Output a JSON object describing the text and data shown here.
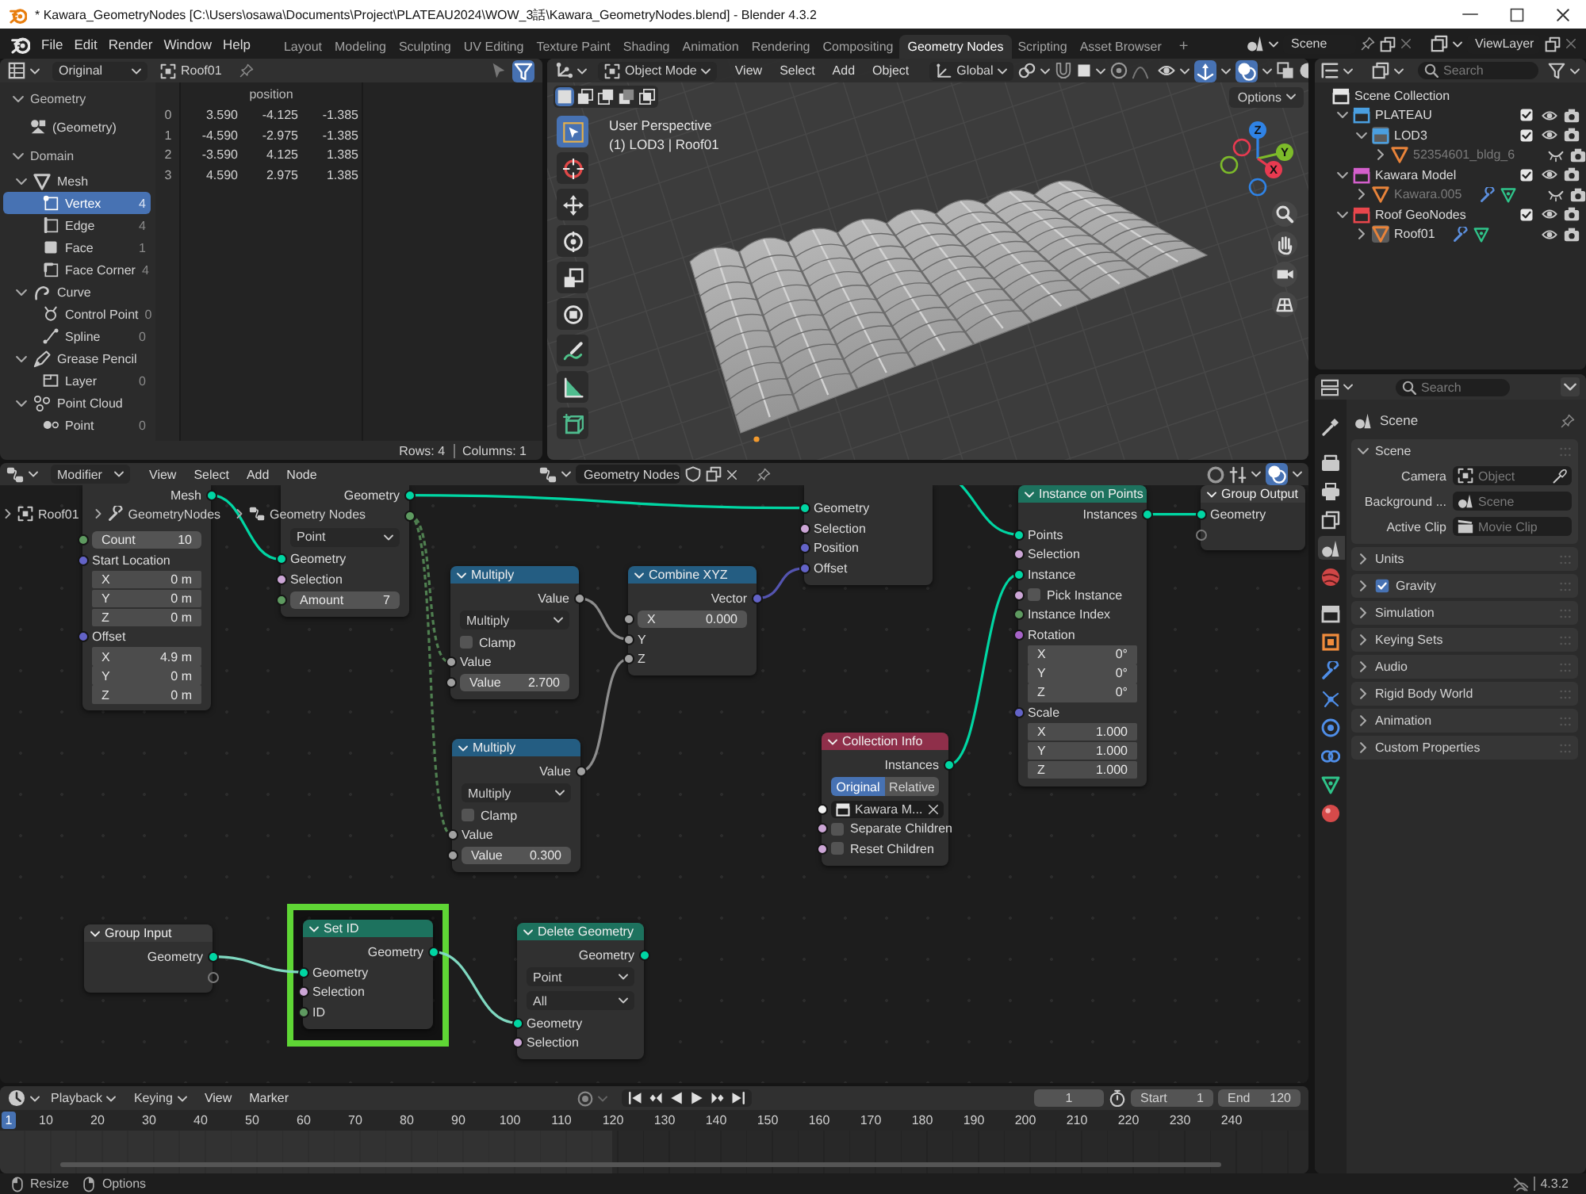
{
  "window": {
    "title": "* Kawara_GeometryNodes [C:\\Users\\osawa\\Documents\\Project\\PLATEAU2024\\WOW_3話\\Kawara_GeometryNodes.blend] - Blender 4.3.2"
  },
  "menu_bar": {
    "menus": [
      "File",
      "Edit",
      "Render",
      "Window",
      "Help"
    ],
    "workspaces": [
      {
        "label": "Layout",
        "selected": false
      },
      {
        "label": "Modeling",
        "selected": false
      },
      {
        "label": "Sculpting",
        "selected": false
      },
      {
        "label": "UV Editing",
        "selected": false
      },
      {
        "label": "Texture Paint",
        "selected": false
      },
      {
        "label": "Shading",
        "selected": false
      },
      {
        "label": "Animation",
        "selected": false
      },
      {
        "label": "Rendering",
        "selected": false
      },
      {
        "label": "Compositing",
        "selected": false
      },
      {
        "label": "Geometry Nodes",
        "selected": true
      },
      {
        "label": "Scripting",
        "selected": false
      },
      {
        "label": "Asset Browser",
        "selected": false
      }
    ],
    "add_workspace": "+",
    "scene": "Scene",
    "view_layer": "ViewLayer"
  },
  "spreadsheet": {
    "display": "Original",
    "object": "Roof01",
    "tree": [
      {
        "label": "Geometry",
        "kind": "section",
        "expanded": true,
        "children": [
          {
            "label": "(Geometry)",
            "kind": "geometry",
            "selected": false
          }
        ]
      },
      {
        "label": "Domain",
        "kind": "section",
        "expanded": true,
        "children": [
          {
            "label": "Mesh",
            "kind": "mesh",
            "expanded": true,
            "children": [
              {
                "label": "Vertex",
                "kind": "vertex",
                "count": "4",
                "selected": true
              },
              {
                "label": "Edge",
                "kind": "edge",
                "count": "4",
                "selected": false
              },
              {
                "label": "Face",
                "kind": "face",
                "count": "1",
                "selected": false
              },
              {
                "label": "Face Corner",
                "kind": "corner",
                "count": "4",
                "selected": false
              }
            ]
          },
          {
            "label": "Curve",
            "kind": "curve",
            "expanded": true,
            "children": [
              {
                "label": "Control Point",
                "kind": "cpoint",
                "count": "0",
                "selected": false
              },
              {
                "label": "Spline",
                "kind": "spline",
                "count": "0",
                "selected": false
              }
            ]
          },
          {
            "label": "Grease Pencil",
            "kind": "gpencil",
            "expanded": true,
            "children": [
              {
                "label": "Layer",
                "kind": "layer",
                "count": "0",
                "selected": false
              }
            ]
          },
          {
            "label": "Point Cloud",
            "kind": "pcloud",
            "expanded": true,
            "children": [
              {
                "label": "Point",
                "kind": "point",
                "count": "0",
                "selected": false
              }
            ]
          }
        ]
      }
    ],
    "columns": [
      "",
      "",
      "position",
      ""
    ],
    "rows": [
      {
        "cells": [
          "0",
          "3.590",
          "-4.125",
          "-1.385"
        ]
      },
      {
        "cells": [
          "1",
          "-4.590",
          "-2.975",
          "-1.385"
        ]
      },
      {
        "cells": [
          "2",
          "-3.590",
          "4.125",
          "1.385"
        ]
      },
      {
        "cells": [
          "3",
          "4.590",
          "2.975",
          "1.385"
        ]
      }
    ],
    "rows_count": "Rows: 4",
    "columns_count": "Columns: 1"
  },
  "viewport": {
    "mode": "Object Mode",
    "menus": [
      "View",
      "Select",
      "Add",
      "Object"
    ],
    "orientation": "Global",
    "options": "Options",
    "select_modes": [
      {
        "kind": "set",
        "selected": true
      },
      {
        "kind": "extend",
        "selected": false
      },
      {
        "kind": "subtract",
        "selected": false
      },
      {
        "kind": "invert",
        "selected": false
      },
      {
        "kind": "intersect",
        "selected": false
      }
    ],
    "tools": [
      {
        "kind": "select_box",
        "selected": true
      },
      {
        "kind": "cursor",
        "selected": false
      },
      {
        "kind": "move",
        "selected": false
      },
      {
        "kind": "rotate",
        "selected": false
      },
      {
        "kind": "scale",
        "selected": false
      },
      {
        "kind": "transform",
        "selected": false
      },
      {
        "kind": "annotate",
        "selected": false
      },
      {
        "kind": "measure",
        "selected": false
      },
      {
        "kind": "add_cube",
        "selected": false
      }
    ],
    "perspective": "User Perspective",
    "object_info": "(1) LOD3 | Roof01",
    "axes": [
      {
        "label": "Z",
        "color": "#2f83e6"
      },
      {
        "label": "Y",
        "color": "#7dbb2a"
      },
      {
        "label": "X",
        "color": "#e83a50"
      }
    ]
  },
  "outliner": {
    "search": {
      "placeholder": "Search"
    },
    "tree": [
      {
        "label": "Scene Collection",
        "kind": "scene_collection",
        "children": [
          {
            "label": "PLATEAU",
            "kind": "collection",
            "color": "#4a9fe0",
            "expanded": true,
            "active": false,
            "checked": true,
            "visible": true,
            "children": [
              {
                "label": "LOD3",
                "kind": "collection",
                "color": "#4a9fe0",
                "expanded": true,
                "active": true,
                "checked": true,
                "visible": true,
                "children": [
                  {
                    "label": "52354601_bldg_6",
                    "kind": "mesh",
                    "expanded": false,
                    "active": false,
                    "disabled": true,
                    "visible": false,
                    "modifiers": false
                  }
                ]
              }
            ]
          },
          {
            "label": "Kawara Model",
            "kind": "collection",
            "color": "#d45fcc",
            "expanded": true,
            "active": false,
            "checked": true,
            "visible": true,
            "children": [
              {
                "label": "Kawara.005",
                "kind": "mesh",
                "expanded": false,
                "active": false,
                "disabled": true,
                "visible": false,
                "modifiers": true
              }
            ]
          },
          {
            "label": "Roof GeoNodes",
            "kind": "collection",
            "color": "#e8464c",
            "expanded": true,
            "active": false,
            "checked": true,
            "visible": true,
            "children": [
              {
                "label": "Roof01",
                "kind": "mesh",
                "expanded": false,
                "active": true,
                "disabled": false,
                "visible": true,
                "modifiers": true
              }
            ]
          }
        ]
      }
    ]
  },
  "properties": {
    "search": {
      "placeholder": "Search"
    },
    "tabs": [
      {
        "kind": "tool",
        "selected": false
      },
      {
        "kind": "render",
        "selected": false
      },
      {
        "kind": "output",
        "selected": false
      },
      {
        "kind": "view_layer",
        "selected": false
      },
      {
        "kind": "scene",
        "selected": true
      },
      {
        "kind": "world",
        "selected": false
      },
      {
        "kind": "collection",
        "selected": false
      },
      {
        "kind": "object",
        "selected": false
      },
      {
        "kind": "modifier",
        "selected": false
      },
      {
        "kind": "particles",
        "selected": false
      },
      {
        "kind": "physics",
        "selected": false
      },
      {
        "kind": "constraints",
        "selected": false
      },
      {
        "kind": "data",
        "selected": false
      },
      {
        "kind": "material",
        "selected": false
      }
    ],
    "title": "Scene",
    "panels": [
      {
        "label": "Scene",
        "expanded": true,
        "fields": [
          {
            "label": "Camera",
            "kind": "object",
            "placeholder": "Object"
          },
          {
            "label": "Background ...",
            "kind": "scene",
            "placeholder": "Scene"
          },
          {
            "label": "Active Clip",
            "kind": "clip",
            "placeholder": "Movie Clip"
          }
        ]
      },
      {
        "label": "Units",
        "expanded": false
      },
      {
        "label": "Gravity",
        "expanded": false,
        "checked": true
      },
      {
        "label": "Simulation",
        "expanded": false
      },
      {
        "label": "Keying Sets",
        "expanded": false
      },
      {
        "label": "Audio",
        "expanded": false
      },
      {
        "label": "Rigid Body World",
        "expanded": false
      },
      {
        "label": "Animation",
        "expanded": false
      },
      {
        "label": "Custom Properties",
        "expanded": false
      }
    ]
  },
  "node_editor": {
    "context": "Modifier",
    "menus": [
      "View",
      "Select",
      "Add",
      "Node"
    ],
    "tree_name": "Geometry Nodes",
    "breadcrumbs": [
      "Roof01",
      "GeometryNodes",
      "Geometry Nodes"
    ],
    "nodes": [
      {
        "highlighted": false,
        "rows": [
          {
            "kind": "out",
            "label": "Mesh",
            "color": "#00d6a3"
          },
          {
            "kind": "field",
            "label": "Count",
            "value": "10",
            "color": "#5e9a60"
          },
          {
            "kind": "in",
            "label": "Start Location",
            "color": "#6363c7"
          },
          {
            "kind": "vec",
            "label": "X",
            "value": "0 m"
          },
          {
            "kind": "vec",
            "label": "Y",
            "value": "0 m"
          },
          {
            "kind": "vec",
            "label": "Z",
            "value": "0 m"
          },
          {
            "kind": "in",
            "label": "Offset",
            "color": "#6363c7"
          },
          {
            "kind": "vec",
            "label": "X",
            "value": "4.9 m"
          },
          {
            "kind": "vec",
            "label": "Y",
            "value": "0 m"
          },
          {
            "kind": "vec",
            "label": "Z",
            "value": "0 m"
          }
        ]
      },
      {
        "highlighted": false,
        "rows": [
          {
            "kind": "out",
            "label": "Geometry",
            "color": "#00d6a3"
          },
          {
            "kind": "out",
            "color": "#5e9a60"
          },
          {
            "kind": "select",
            "value": "Point"
          },
          {
            "kind": "in",
            "label": "Geometry",
            "color": "#00d6a3"
          },
          {
            "kind": "in",
            "label": "Selection",
            "color": "#cca6d6"
          },
          {
            "kind": "field",
            "label": "Amount",
            "value": "7",
            "color": "#5e9a60"
          }
        ]
      },
      {
        "title": "Multiply",
        "color": "#245d82",
        "highlighted": false,
        "rows": [
          {
            "kind": "out",
            "label": "Value",
            "color": "#a1a1a1"
          },
          {
            "kind": "select",
            "value": "Multiply"
          },
          {
            "kind": "check",
            "label": "Clamp",
            "checked": false
          },
          {
            "kind": "in",
            "label": "Value",
            "color": "#a1a1a1"
          },
          {
            "kind": "field",
            "label": "Value",
            "value": "2.700",
            "color": "#a1a1a1"
          }
        ]
      },
      {
        "title": "Combine XYZ",
        "color": "#245d82",
        "highlighted": false,
        "rows": [
          {
            "kind": "out",
            "label": "Vector",
            "color": "#6363c7"
          },
          {
            "kind": "field",
            "label": "X",
            "value": "0.000",
            "color": "#a1a1a1"
          },
          {
            "kind": "in",
            "label": "Y",
            "color": "#a1a1a1"
          },
          {
            "kind": "in",
            "label": "Z",
            "color": "#a1a1a1"
          }
        ]
      },
      {
        "title": "Multiply",
        "color": "#245d82",
        "highlighted": false,
        "rows": [
          {
            "kind": "out",
            "label": "Value",
            "color": "#a1a1a1"
          },
          {
            "kind": "select",
            "value": "Multiply"
          },
          {
            "kind": "check",
            "label": "Clamp",
            "checked": false
          },
          {
            "kind": "in",
            "label": "Value",
            "color": "#a1a1a1"
          },
          {
            "kind": "field",
            "label": "Value",
            "value": "0.300",
            "color": "#a1a1a1"
          }
        ]
      },
      {
        "highlighted": false,
        "rows": [
          {
            "kind": "in",
            "label": "Geometry",
            "color": "#00d6a3"
          },
          {
            "kind": "in",
            "label": "Selection",
            "color": "#cca6d6"
          },
          {
            "kind": "in",
            "label": "Position",
            "color": "#6363c7"
          },
          {
            "kind": "in",
            "label": "Offset",
            "color": "#6363c7"
          }
        ]
      },
      {
        "title": "Instance on Points",
        "color": "#1d725e",
        "highlighted": false,
        "rows": [
          {
            "kind": "out",
            "label": "Instances",
            "color": "#00d6a3"
          },
          {
            "kind": "in",
            "label": "Points",
            "color": "#00d6a3"
          },
          {
            "kind": "in",
            "label": "Selection",
            "color": "#cca6d6"
          },
          {
            "kind": "in",
            "label": "Instance",
            "color": "#00d6a3"
          },
          {
            "kind": "check",
            "label": "Pick Instance",
            "checked": false,
            "color": "#cca6d6"
          },
          {
            "kind": "in",
            "label": "Instance Index",
            "color": "#5e9a60"
          },
          {
            "kind": "in",
            "label": "Rotation",
            "color": "#a663c7"
          },
          {
            "kind": "vec",
            "label": "X",
            "value": "0°"
          },
          {
            "kind": "vec",
            "label": "Y",
            "value": "0°"
          },
          {
            "kind": "vec",
            "label": "Z",
            "value": "0°"
          },
          {
            "kind": "in",
            "label": "Scale",
            "color": "#6363c7"
          },
          {
            "kind": "vec",
            "label": "X",
            "value": "1.000"
          },
          {
            "kind": "vec",
            "label": "Y",
            "value": "1.000"
          },
          {
            "kind": "vec",
            "label": "Z",
            "value": "1.000"
          }
        ]
      },
      {
        "title": "Group Output",
        "color": "#3a3a3a",
        "highlighted": false,
        "rows": [
          {
            "kind": "in",
            "label": "Geometry",
            "color": "#00d6a3"
          },
          {
            "kind": "virtual_in"
          }
        ]
      },
      {
        "title": "Collection Info",
        "color": "#8f2f4a",
        "highlighted": false,
        "rows": [
          {
            "kind": "out",
            "label": "Instances",
            "color": "#00d6a3"
          },
          {
            "kind": "toggle",
            "options": [
              {
                "label": "Original",
                "selected": true
              },
              {
                "label": "Relative",
                "selected": false
              }
            ]
          },
          {
            "kind": "picker",
            "value": "Kawara M...",
            "color": "#f2f2f2"
          },
          {
            "kind": "check",
            "label": "Separate Children",
            "checked": false,
            "color": "#cca6d6"
          },
          {
            "kind": "check",
            "label": "Reset Children",
            "checked": false,
            "color": "#cca6d6"
          }
        ]
      },
      {
        "title": "Group Input",
        "color": "#3a3a3a",
        "highlighted": false,
        "rows": [
          {
            "kind": "out",
            "label": "Geometry",
            "color": "#00d6a3"
          },
          {
            "kind": "virtual_out"
          }
        ]
      },
      {
        "title": "Set ID",
        "color": "#1d725e",
        "highlighted": true,
        "rows": [
          {
            "kind": "out",
            "label": "Geometry",
            "color": "#00d6a3"
          },
          {
            "kind": "in",
            "label": "Geometry",
            "color": "#00d6a3"
          },
          {
            "kind": "in",
            "label": "Selection",
            "color": "#cca6d6"
          },
          {
            "kind": "in",
            "label": "ID",
            "color": "#5e9a60"
          }
        ]
      },
      {
        "title": "Delete Geometry",
        "color": "#1d725e",
        "highlighted": false,
        "rows": [
          {
            "kind": "out",
            "label": "Geometry",
            "color": "#00d6a3"
          },
          {
            "kind": "select",
            "value": "Point"
          },
          {
            "kind": "select",
            "value": "All"
          },
          {
            "kind": "in",
            "label": "Geometry",
            "color": "#00d6a3"
          },
          {
            "kind": "in",
            "label": "Selection",
            "color": "#cca6d6"
          }
        ]
      }
    ]
  },
  "timeline": {
    "menus": [
      {
        "label": "Playback",
        "kind": "dropdown"
      },
      {
        "label": "Keying",
        "kind": "dropdown"
      },
      {
        "label": "View",
        "kind": "menu"
      },
      {
        "label": "Marker",
        "kind": "menu"
      }
    ],
    "frame": "1",
    "start_label": "Start",
    "start": "1",
    "end_label": "End",
    "end": "120",
    "playhead": "1",
    "ruler": [
      "10",
      "20",
      "30",
      "40",
      "50",
      "60",
      "70",
      "80",
      "90",
      "100",
      "110",
      "120",
      "130",
      "140",
      "150",
      "160",
      "170",
      "180",
      "190",
      "200",
      "210",
      "220",
      "230",
      "240"
    ]
  },
  "status_bar": {
    "items": [
      {
        "kind": "mouse_left",
        "label": "Resize"
      },
      {
        "kind": "mouse_right",
        "label": "Options"
      }
    ],
    "version": "4.3.2"
  }
}
